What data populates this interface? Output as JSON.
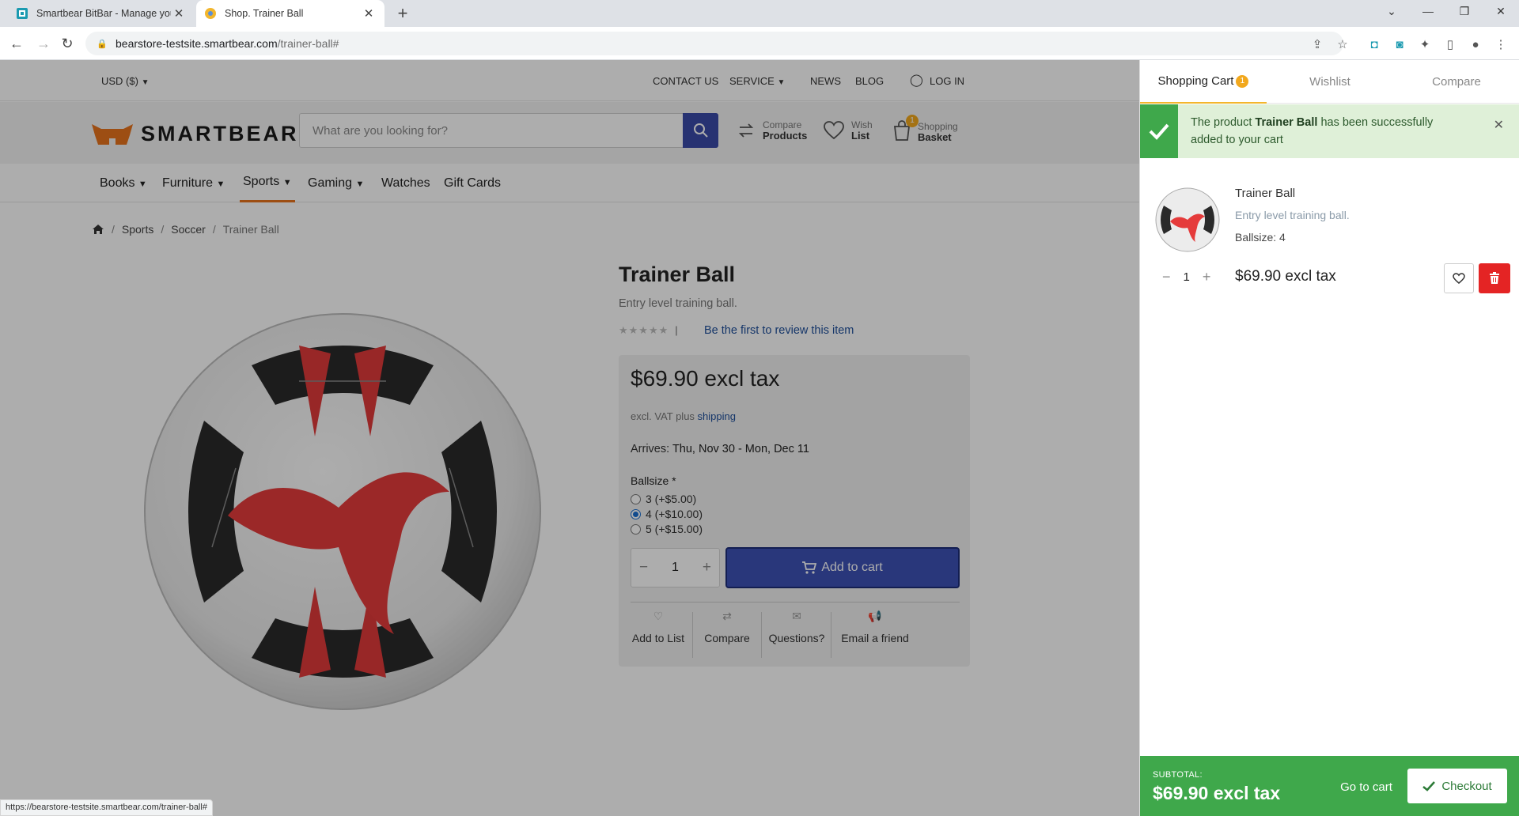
{
  "browser": {
    "tabs": [
      {
        "title": "Smartbear BitBar - Manage your"
      },
      {
        "title": "Shop. Trainer Ball"
      }
    ],
    "url_host": "bearstore-testsite.smartbear.com",
    "url_path": "/trainer-ball#",
    "status_url": "https://bearstore-testsite.smartbear.com/trainer-ball#"
  },
  "topbar": {
    "currency": "USD ($)",
    "contact": "CONTACT US",
    "service": "SERVICE",
    "news": "NEWS",
    "blog": "BLOG",
    "login": "LOG IN"
  },
  "header": {
    "logo_text": "SMARTBEAR",
    "search_placeholder": "What are you looking for?",
    "compare_top": "Compare",
    "compare_bottom": "Products",
    "wish_top": "Wish",
    "wish_bottom": "List",
    "basket_top": "Shopping",
    "basket_bottom": "Basket",
    "basket_count": "1"
  },
  "menu": [
    "Books",
    "Furniture",
    "Sports",
    "Gaming",
    "Watches",
    "Gift Cards"
  ],
  "breadcrumb": [
    "Sports",
    "Soccer",
    "Trainer Ball"
  ],
  "product": {
    "title": "Trainer Ball",
    "subtitle": "Entry level training ball.",
    "review_link": "Be the first to review this item",
    "price": "$69.90 excl tax",
    "vat_prefix": "excl. VAT plus",
    "vat_link": "shipping",
    "arrives_label": "Arrives:",
    "arrives_value": "Thu, Nov 30 - Mon, Dec 11",
    "ballsize_label": "Ballsize *",
    "options": [
      "3 (+$5.00)",
      "4 (+$10.00)",
      "5 (+$15.00)"
    ],
    "selected_option": "4 (+$10.00)",
    "quantity": "1",
    "add_to_cart": "Add to cart",
    "actions": [
      "Add to List",
      "Compare",
      "Questions?",
      "Email a friend"
    ]
  },
  "cart_panel": {
    "tabs": {
      "cart": "Shopping Cart",
      "cart_count": "1",
      "wishlist": "Wishlist",
      "compare": "Compare"
    },
    "notice_pre": "The product",
    "notice_product": "Trainer Ball",
    "notice_post": "has been successfully added to your cart",
    "item": {
      "name": "Trainer Ball",
      "desc": "Entry level training ball.",
      "attr": "Ballsize: 4",
      "qty": "1",
      "price": "$69.90 excl tax"
    },
    "subtotal_label": "SUBTOTAL:",
    "subtotal_value": "$69.90 excl tax",
    "go_to_cart": "Go to cart",
    "checkout": "Checkout"
  },
  "colors": {
    "accent": "#3d51b5",
    "brand_orange": "#e8731d",
    "success": "#3fa84b",
    "danger": "#e42424"
  }
}
